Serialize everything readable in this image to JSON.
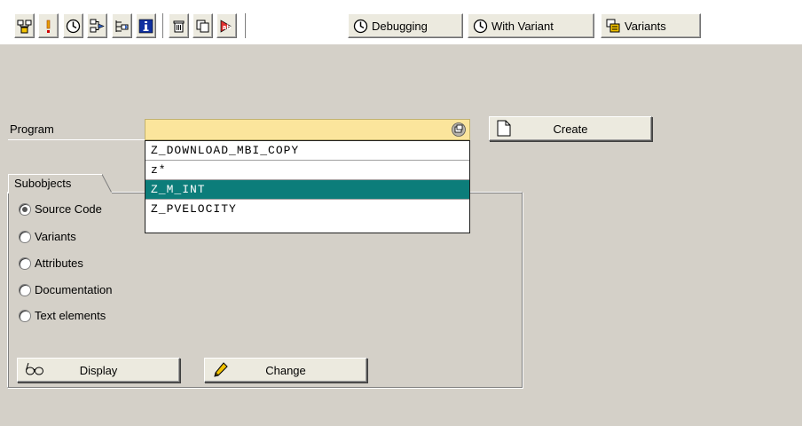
{
  "toolbar": {
    "debugging_label": "Debugging",
    "with_variant_label": "With Variant",
    "variants_label": "Variants",
    "icons": [
      "hierarchy-icon",
      "exclamation-icon",
      "execute-icon",
      "where-used-icon",
      "navigate-icon",
      "info-icon",
      "delete-icon",
      "copy-icon",
      "rename-icon"
    ]
  },
  "program": {
    "label": "Program",
    "value": "",
    "create_label": "Create",
    "dropdown_items": [
      "Z_DOWNLOAD_MBI_COPY",
      "z*",
      "Z_M_INT",
      "Z_PVELOCITY"
    ],
    "dropdown_selected_index": 2
  },
  "subobjects": {
    "tab_label": "Subobjects",
    "options": [
      "Source Code",
      "Variants",
      "Attributes",
      "Documentation",
      "Text elements"
    ],
    "selected_index": 0,
    "display_label": "Display",
    "change_label": "Change"
  },
  "colors": {
    "background": "#d4d0c8",
    "input_required": "#fbe59c",
    "selection": "#0c7d7a"
  }
}
